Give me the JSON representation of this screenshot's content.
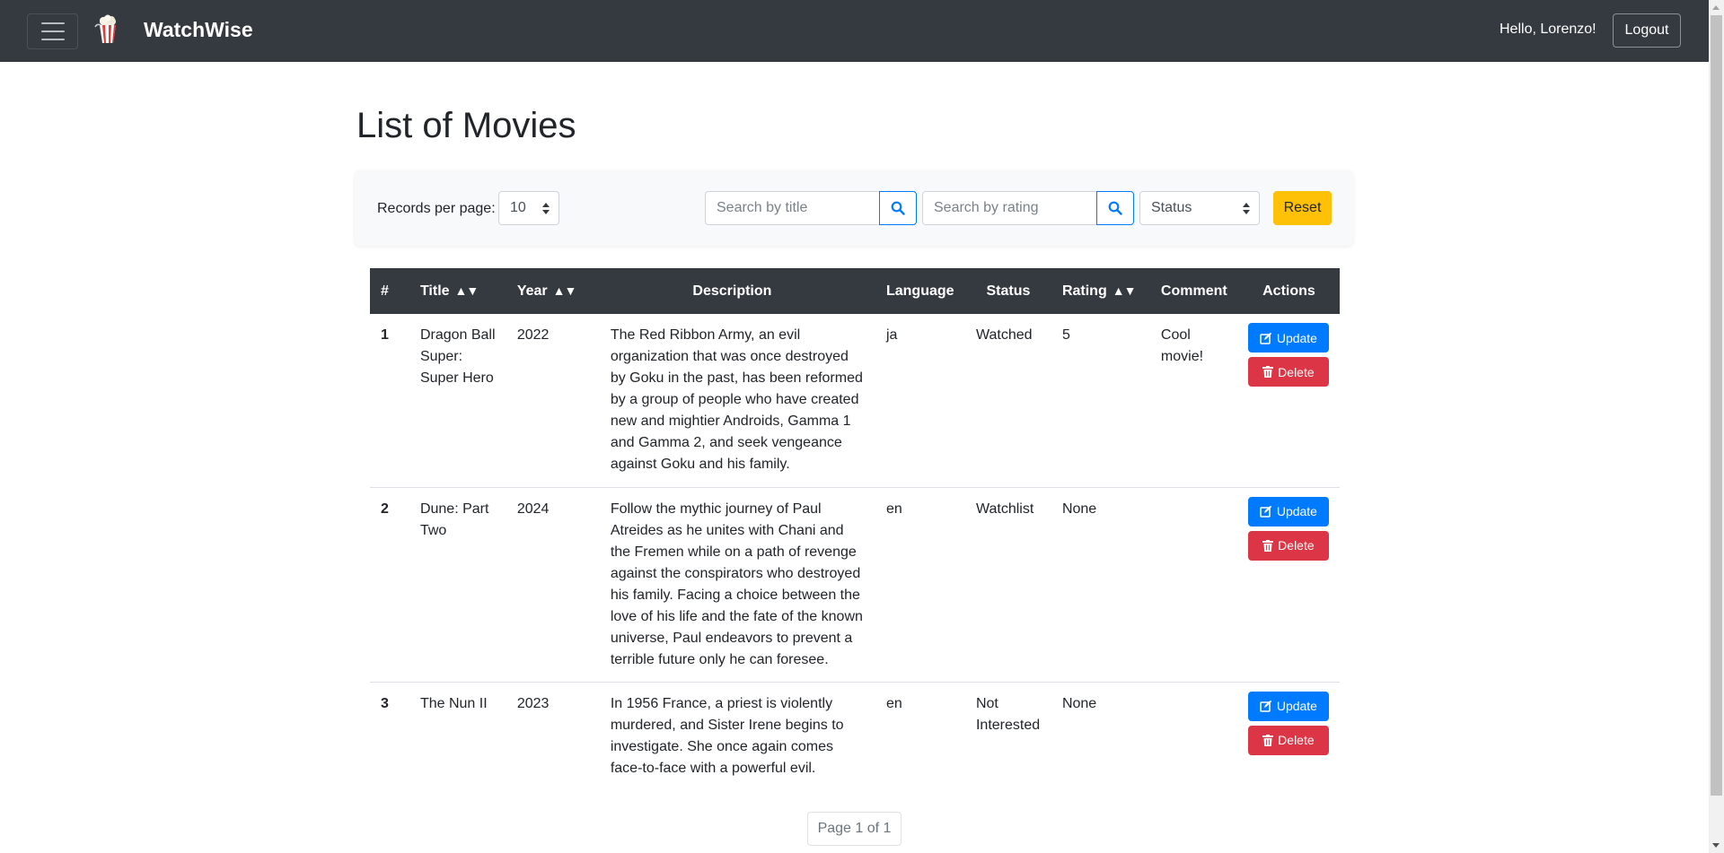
{
  "navbar": {
    "brand": "WatchWise",
    "greeting": "Hello, Lorenzo!",
    "logout_label": "Logout"
  },
  "page": {
    "title": "List of Movies"
  },
  "filters": {
    "records_per_page_label": "Records per page:",
    "records_per_page_value": "10",
    "search_title_placeholder": "Search by title",
    "search_rating_placeholder": "Search by rating",
    "status_value": "Status",
    "reset_label": "Reset"
  },
  "table": {
    "headers": {
      "num": "#",
      "title": "Title",
      "year": "Year",
      "description": "Description",
      "language": "Language",
      "status": "Status",
      "rating": "Rating",
      "comment": "Comment",
      "actions": "Actions",
      "sort_arrows": "▲▼"
    },
    "update_label": "Update",
    "delete_label": "Delete",
    "rows": [
      {
        "num": "1",
        "title": "Dragon Ball Super: Super Hero",
        "year": "2022",
        "description": "The Red Ribbon Army, an evil organization that was once destroyed by Goku in the past, has been reformed by a group of people who have created new and mightier Androids, Gamma 1 and Gamma 2, and seek vengeance against Goku and his family.",
        "language": "ja",
        "status": "Watched",
        "rating": "5",
        "comment": "Cool movie!"
      },
      {
        "num": "2",
        "title": "Dune: Part Two",
        "year": "2024",
        "description": "Follow the mythic journey of Paul Atreides as he unites with Chani and the Fremen while on a path of revenge against the conspirators who destroyed his family. Facing a choice between the love of his life and the fate of the known universe, Paul endeavors to prevent a terrible future only he can foresee.",
        "language": "en",
        "status": "Watchlist",
        "rating": "None",
        "comment": ""
      },
      {
        "num": "3",
        "title": "The Nun II",
        "year": "2023",
        "description": "In 1956 France, a priest is violently murdered, and Sister Irene begins to investigate. She once again comes face-to-face with a powerful evil.",
        "language": "en",
        "status": "Not Interested",
        "rating": "None",
        "comment": ""
      }
    ]
  },
  "pagination": {
    "label": "Page 1 of 1"
  },
  "colors": {
    "navbar": "#343a40",
    "primary": "#007bff",
    "danger": "#dc3545",
    "warning": "#ffc107"
  }
}
